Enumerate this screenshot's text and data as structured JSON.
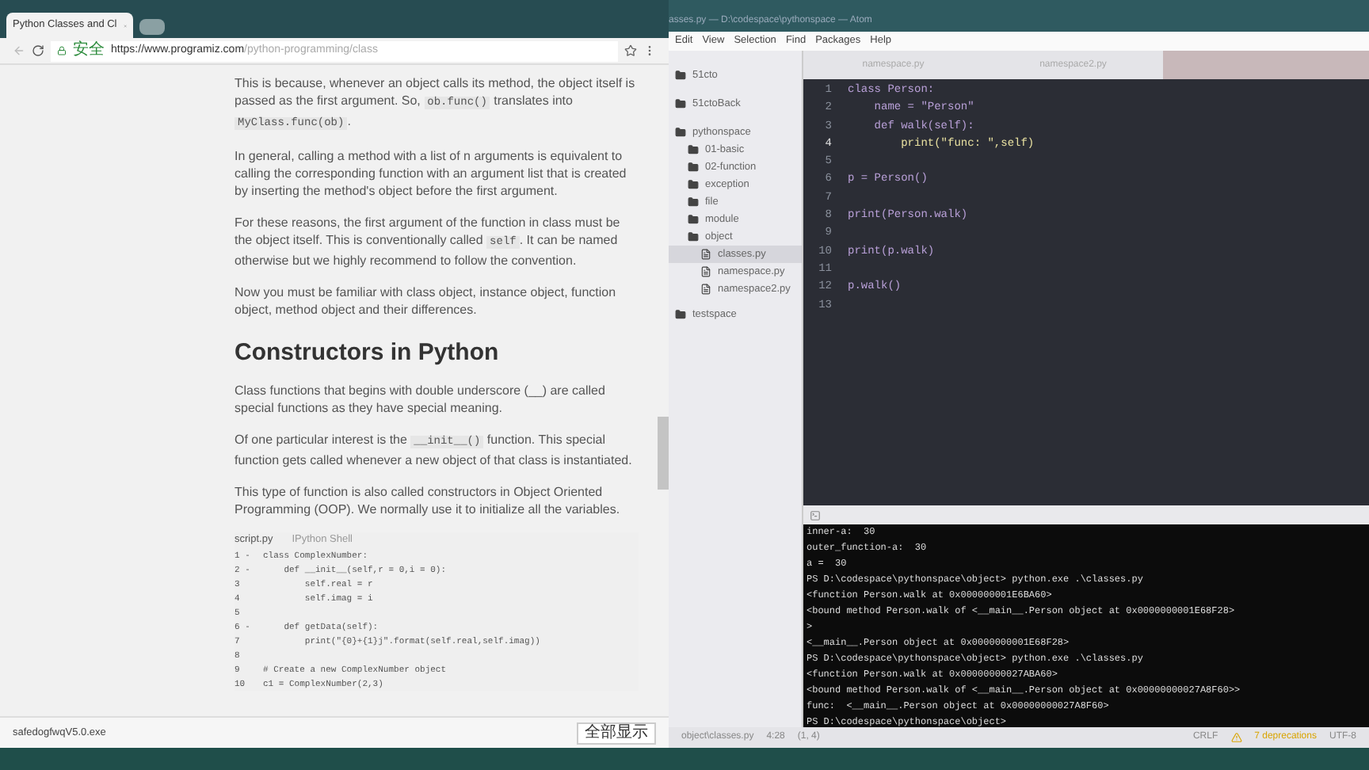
{
  "browser": {
    "tab_title": "Python Classes and Cl",
    "security_label": "安全",
    "url_host": "https://www.programiz.com",
    "url_path": "/python-programming/class",
    "article": [
      {
        "kind": "paragraph",
        "segments": [
          {
            "text": "This is because, whenever an object calls its method, the object itself is passed as the first argument. So, ",
            "code": false
          },
          {
            "text": "ob.func()",
            "code": true
          },
          {
            "text": " translates into ",
            "code": false
          },
          {
            "text": "MyClass.func(ob)",
            "code": true
          },
          {
            "text": ".",
            "code": false
          }
        ]
      },
      {
        "kind": "paragraph",
        "segments": [
          {
            "text": "In general, calling a method with a list of n arguments is equivalent to calling the corresponding function with an argument list that is created by inserting the method's object before the first argument.",
            "code": false
          }
        ]
      },
      {
        "kind": "paragraph",
        "segments": [
          {
            "text": "For these reasons, the first argument of the function in class must be the object itself. This is conventionally called ",
            "code": false
          },
          {
            "text": "self",
            "code": true
          },
          {
            "text": ". It can be named otherwise but we highly recommend to follow the convention.",
            "code": false
          }
        ]
      },
      {
        "kind": "paragraph",
        "segments": [
          {
            "text": "Now you must be familiar with class object, instance object, function object, method object and their differences.",
            "code": false
          }
        ]
      },
      {
        "kind": "heading",
        "segments": [
          {
            "text": "Constructors in Python",
            "code": false
          }
        ]
      },
      {
        "kind": "paragraph",
        "segments": [
          {
            "text": "Class functions that begins with double underscore (__) are called special functions as they have special meaning.",
            "code": false
          }
        ]
      },
      {
        "kind": "paragraph",
        "segments": [
          {
            "text": "Of one particular interest is the ",
            "code": false
          },
          {
            "text": "__init__()",
            "code": true
          },
          {
            "text": " function. This special function gets called whenever a new object of that class is instantiated.",
            "code": false
          }
        ]
      },
      {
        "kind": "paragraph",
        "segments": [
          {
            "text": "This type of function is also called constructors in Object Oriented Programming (OOP). We normally use it to initialize all the variables.",
            "code": false
          }
        ]
      }
    ],
    "snippet": {
      "tabs": [
        {
          "label": "script.py",
          "selected": true
        },
        {
          "label": "IPython Shell",
          "selected": false
        }
      ],
      "lines": [
        {
          "number": "1",
          "fold": "-",
          "code": "class ComplexNumber:"
        },
        {
          "number": "2",
          "fold": "-",
          "code": "    def __init__(self,r = 0,i = 0):"
        },
        {
          "number": "3",
          "code": "        self.real = r"
        },
        {
          "number": "4",
          "code": "        self.imag = i"
        },
        {
          "number": "5"
        },
        {
          "number": "6",
          "fold": "-",
          "code": "    def getData(self):"
        },
        {
          "number": "7",
          "code": "        print(\"{0}+{1}j\".format(self.real,self.imag))"
        },
        {
          "number": "8"
        },
        {
          "number": "9",
          "code": "# Create a new ComplexNumber object"
        },
        {
          "number": "10",
          "code": "c1 = ComplexNumber(2,3)"
        }
      ]
    },
    "download": {
      "file": "safedogfwqV5.0.exe",
      "show_all": "全部显示"
    }
  },
  "editor": {
    "title": "asses.py — D:\\codespace\\pythonspace — Atom",
    "menu": [
      "Edit",
      "View",
      "Selection",
      "Find",
      "Packages",
      "Help"
    ],
    "tabs": [
      {
        "label": "namespace.py",
        "selected": false
      },
      {
        "label": "namespace2.py",
        "selected": false
      }
    ],
    "tree": [
      {
        "kind": "folder",
        "name": "51cto",
        "selected": false
      },
      {
        "kind": "folder",
        "name": "51ctoBack",
        "selected": false
      },
      {
        "kind": "folder",
        "name": "pythonspace",
        "selected": false,
        "children": [
          {
            "kind": "folder",
            "name": "01-basic",
            "selected": false
          },
          {
            "kind": "folder",
            "name": "02-function",
            "selected": false
          },
          {
            "kind": "folder",
            "name": "exception",
            "selected": false
          },
          {
            "kind": "folder",
            "name": "file",
            "selected": false
          },
          {
            "kind": "folder",
            "name": "module",
            "selected": false
          },
          {
            "kind": "folder",
            "name": "object",
            "selected": false,
            "children": [
              {
                "kind": "file",
                "name": "classes.py",
                "selected": true
              },
              {
                "kind": "file",
                "name": "namespace.py",
                "selected": false
              },
              {
                "kind": "file",
                "name": "namespace2.py",
                "selected": false
              }
            ]
          }
        ]
      },
      {
        "kind": "folder",
        "name": "testspace",
        "selected": false
      }
    ],
    "code": [
      {
        "number": "1",
        "text": "class Person:",
        "selected": false
      },
      {
        "number": "2",
        "text": "    name = \"Person\"",
        "selected": false
      },
      {
        "number": "3",
        "text": "    def walk(self):",
        "selected": false
      },
      {
        "number": "4",
        "text": "        print(\"func: \",self)",
        "selected": true
      },
      {
        "number": "5",
        "selected": false
      },
      {
        "number": "6",
        "text": "p = Person()",
        "selected": false
      },
      {
        "number": "7",
        "selected": false
      },
      {
        "number": "8",
        "text": "print(Person.walk)",
        "selected": false
      },
      {
        "number": "9",
        "selected": false
      },
      {
        "number": "10",
        "text": "print(p.walk)",
        "selected": false
      },
      {
        "number": "11",
        "selected": false
      },
      {
        "number": "12",
        "text": "p.walk()",
        "selected": false
      },
      {
        "number": "13",
        "selected": false
      }
    ],
    "terminal": [
      "inner-a:  30",
      "outer_function-a:  30",
      "a =  30",
      "PS D:\\codespace\\pythonspace\\object> python.exe .\\classes.py",
      "<function Person.walk at 0x000000001E6BA60>",
      "<bound method Person.walk of <__main__.Person object at 0x0000000001E68F28>",
      ">",
      "<__main__.Person object at 0x0000000001E68F28>",
      "PS D:\\codespace\\pythonspace\\object> python.exe .\\classes.py",
      "<function Person.walk at 0x00000000027ABA60>",
      "<bound method Person.walk of <__main__.Person object at 0x00000000027A8F60>>",
      "func:  <__main__.Person object at 0x00000000027A8F60>",
      "PS D:\\codespace\\pythonspace\\object>"
    ],
    "status": {
      "path": "object\\classes.py",
      "cursor": "4:28",
      "selection": "(1, 4)",
      "line_ending": "CRLF",
      "warnings": "7 deprecations",
      "encoding": "UTF-8"
    }
  }
}
